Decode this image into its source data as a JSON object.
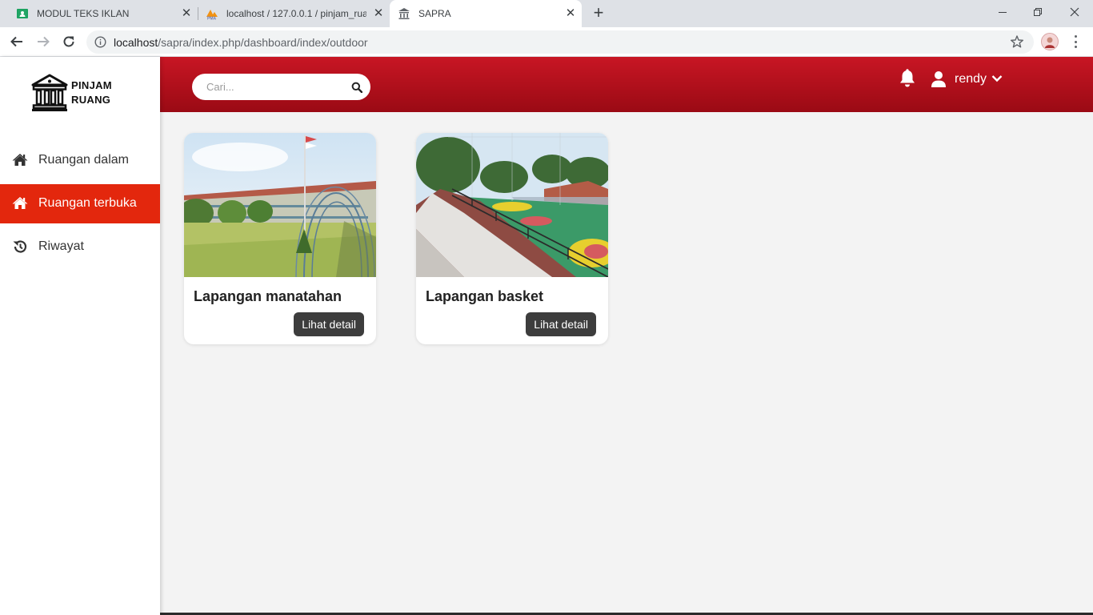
{
  "browser": {
    "tabs": [
      {
        "title": "MODUL TEKS IKLAN",
        "icon": "classroom-icon"
      },
      {
        "title": "localhost / 127.0.0.1 / pinjam_ruang",
        "icon": "phpmyadmin-icon"
      },
      {
        "title": "SAPRA",
        "icon": "building-icon",
        "active": true
      }
    ],
    "url_host": "localhost",
    "url_path": "/sapra/index.php/dashboard/index/outdoor"
  },
  "sidebar": {
    "logo_line1": "PINJAM",
    "logo_line2": "RUANG",
    "items": [
      {
        "label": "Ruangan dalam",
        "icon": "home-icon"
      },
      {
        "label": "Ruangan terbuka",
        "icon": "home-icon",
        "active": true
      },
      {
        "label": "Riwayat",
        "icon": "history-icon"
      }
    ]
  },
  "header": {
    "search_placeholder": "Cari...",
    "username": "rendy"
  },
  "cards": [
    {
      "title": "Lapangan manatahan",
      "button": "Lihat detail"
    },
    {
      "title": "Lapangan basket",
      "button": "Lihat detail"
    }
  ],
  "colors": {
    "header": "#b1101c",
    "active_menu": "#e3270d",
    "button": "#3d3d3d",
    "background": "#f3f3f3"
  }
}
